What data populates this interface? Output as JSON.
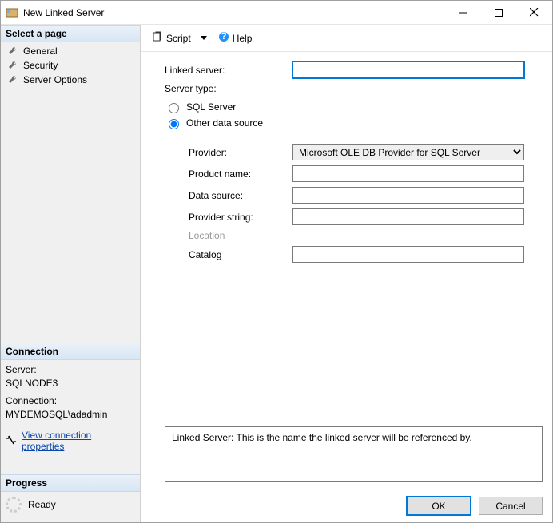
{
  "window": {
    "title": "New Linked Server"
  },
  "sidebar": {
    "select_page_header": "Select a page",
    "pages": [
      {
        "label": "General"
      },
      {
        "label": "Security"
      },
      {
        "label": "Server Options"
      }
    ],
    "connection_header": "Connection",
    "server_label": "Server:",
    "server_value": "SQLNODE3",
    "connection_label": "Connection:",
    "connection_value": "MYDEMOSQL\\adadmin",
    "view_conn_link": "View connection properties",
    "progress_header": "Progress",
    "progress_status": "Ready"
  },
  "toolbar": {
    "script_label": "Script",
    "help_label": "Help"
  },
  "form": {
    "linked_server_label": "Linked server:",
    "linked_server_value": "",
    "server_type_label": "Server type:",
    "radio_sql": "SQL Server",
    "radio_other": "Other data source",
    "provider_label": "Provider:",
    "provider_value": "Microsoft OLE DB Provider for SQL Server",
    "product_name_label": "Product name:",
    "product_name_value": "",
    "data_source_label": "Data source:",
    "data_source_value": "",
    "provider_string_label": "Provider string:",
    "provider_string_value": "",
    "location_label": "Location",
    "catalog_label": "Catalog",
    "catalog_value": ""
  },
  "hint": "Linked Server: This is the name the linked server will be referenced by.",
  "footer": {
    "ok": "OK",
    "cancel": "Cancel"
  }
}
